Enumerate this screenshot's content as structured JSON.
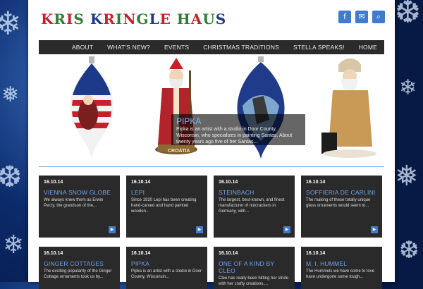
{
  "site": {
    "logo_text": "KRIS KRINGLE HAUS"
  },
  "social": [
    {
      "name": "facebook-icon",
      "glyph": "f"
    },
    {
      "name": "email-icon",
      "glyph": "✉"
    },
    {
      "name": "search-icon",
      "glyph": "⌕"
    }
  ],
  "nav": {
    "items": [
      "ABOUT",
      "WHAT'S NEW?",
      "EVENTS",
      "CHRISTMAS TRADITIONS",
      "STELLA SPEAKS!",
      "HOME"
    ]
  },
  "hero": {
    "caption_title": "PIPKA",
    "caption_text": "Pipka is an artist with a studio in Door County, Wisconsin, who specializes in painting Santas. About twenty years ago five of her Santas...",
    "stand_label": "CROATIA"
  },
  "cards": [
    {
      "date": "16.10.14",
      "title": "VIENNA SNOW GLOBE",
      "excerpt": "We always knew them as Erwin Perzy, the grandson of the..."
    },
    {
      "date": "16.10.14",
      "title": "LEPI",
      "excerpt": "Since 1920 Lepi has been creating hand-carved and hand painted wooden..."
    },
    {
      "date": "16.10.14",
      "title": "STEINBACH",
      "excerpt": "The largest, best-known, and finest manufacturer of nutcrackers in Germany, with..."
    },
    {
      "date": "16.10.14",
      "title": "SOFFIERIA DE CARLINI",
      "excerpt": "The making of these totally unique glass ornaments would seem to..."
    },
    {
      "date": "16.10.14",
      "title": "GINGER COTTAGES",
      "excerpt": "The exciting popularity of the Ginger Cottage ornaments took us by..."
    },
    {
      "date": "16.10.14",
      "title": "PIPKA",
      "excerpt": "Pipka is an artist with a studio in Door County, Wisconsin..."
    },
    {
      "date": "16.10.14",
      "title": "ONE OF A KIND BY CLEO",
      "excerpt": "Cleo has really been hitting her stride with her crafty creations,..."
    },
    {
      "date": "16.10.14",
      "title": "M. I. HUMMEL",
      "excerpt": "The Hummels we have come to love have undergone some tough..."
    }
  ],
  "colors": {
    "accent": "#3f7ccf",
    "title_blue": "#6ea4f0",
    "nav_bg": "#2b2b2b",
    "card_bg": "#2a2a2a"
  }
}
